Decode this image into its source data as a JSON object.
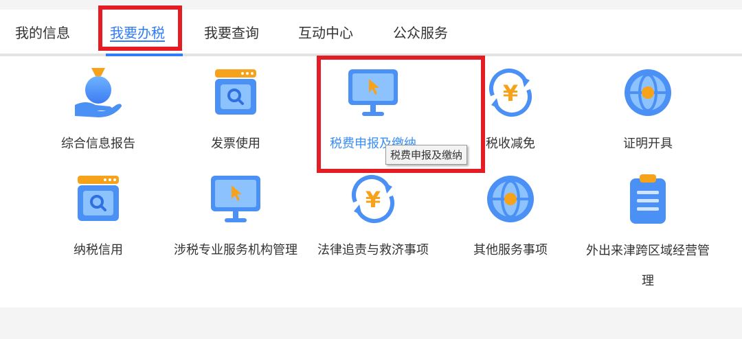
{
  "tabs": [
    {
      "label": "我的信息"
    },
    {
      "label": "我要办税"
    },
    {
      "label": "我要查询"
    },
    {
      "label": "互动中心"
    },
    {
      "label": "公众服务"
    }
  ],
  "active_tab": "我要办税",
  "items": [
    {
      "label": "综合信息报告",
      "icon": "money-bag-hand-icon"
    },
    {
      "label": "发票使用",
      "icon": "search-window-icon"
    },
    {
      "label": "税费申报及缴纳",
      "icon": "monitor-cursor-icon"
    },
    {
      "label": "税收减免",
      "icon": "yuan-refresh-icon"
    },
    {
      "label": "证明开具",
      "icon": "globe-icon"
    },
    {
      "label": "纳税信用",
      "icon": "search-window-icon"
    },
    {
      "label": "涉税专业服务机构管理",
      "icon": "monitor-cursor-icon"
    },
    {
      "label": "法律追责与救济事项",
      "icon": "yuan-refresh-icon"
    },
    {
      "label": "其他服务事项",
      "icon": "globe-icon"
    },
    {
      "label": "外出来津跨区域经营管理",
      "icon": "clipboard-icon"
    }
  ],
  "tooltip": "税费申报及缴纳",
  "colors": {
    "accent": "#2f7cf6",
    "highlight_box": "#e41d25",
    "icon_blue": "#4a90f5",
    "icon_orange": "#f7a21b"
  }
}
